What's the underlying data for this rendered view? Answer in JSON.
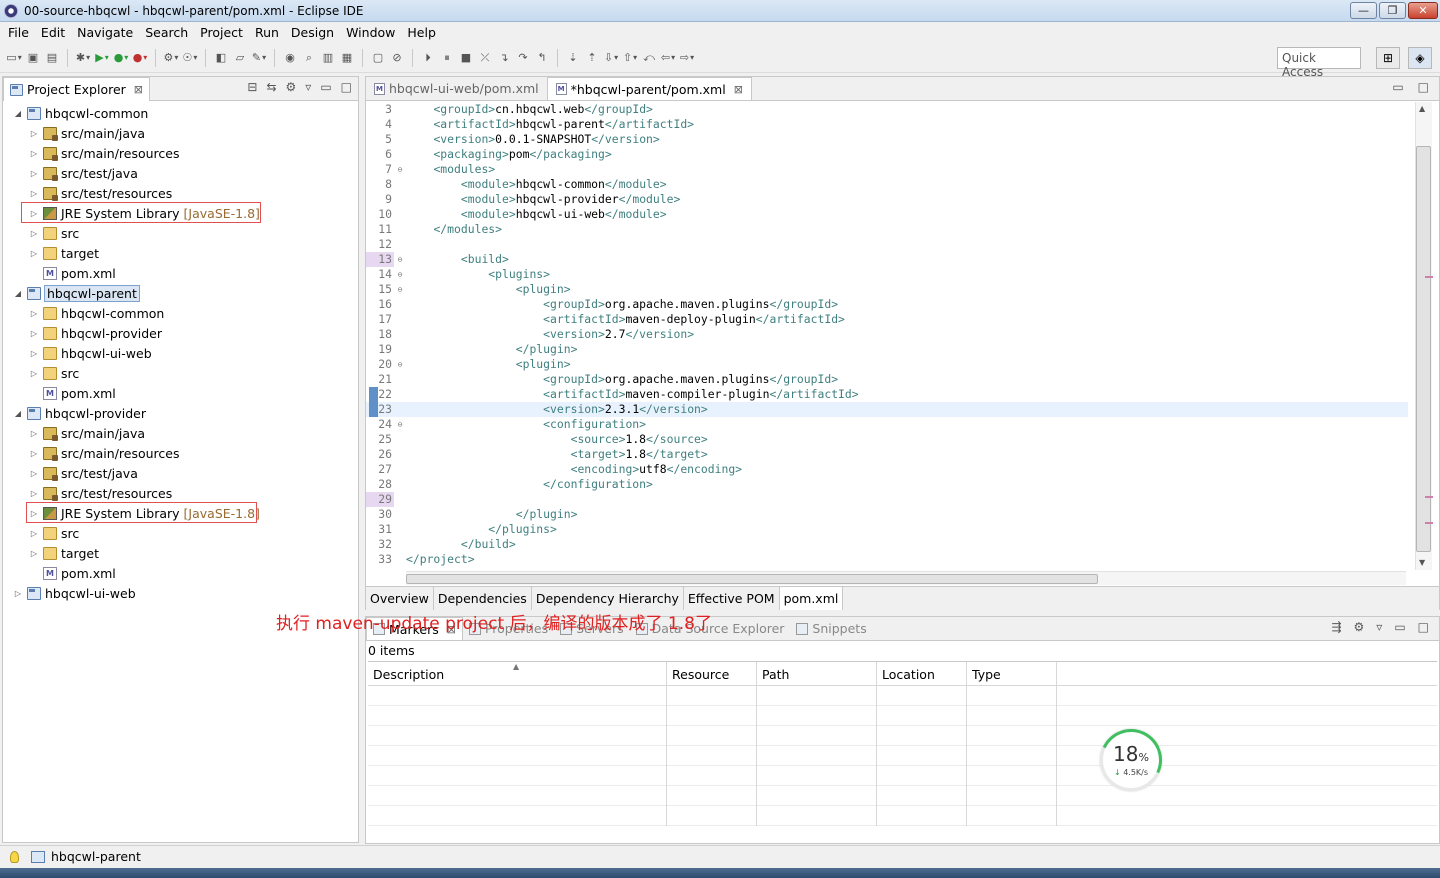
{
  "window": {
    "title": "00-source-hbqcwl - hbqcwl-parent/pom.xml - Eclipse IDE",
    "buttons": [
      "—",
      "❐",
      "✕"
    ]
  },
  "menu": [
    "File",
    "Edit",
    "Navigate",
    "Search",
    "Project",
    "Run",
    "Design",
    "Window",
    "Help"
  ],
  "toolbar": {
    "quick_access": "Quick Access"
  },
  "explorer": {
    "title": "Project Explorer",
    "tree": [
      {
        "label": "hbqcwl-common",
        "icon": "project",
        "level": 0,
        "expanded": true
      },
      {
        "label": "src/main/java",
        "icon": "srcfolder",
        "level": 1
      },
      {
        "label": "src/main/resources",
        "icon": "srcfolder",
        "level": 1
      },
      {
        "label": "src/test/java",
        "icon": "srcfolder",
        "level": 1
      },
      {
        "label": "src/test/resources",
        "icon": "srcfolder",
        "level": 1
      },
      {
        "label": "JRE System Library",
        "extra": "[JavaSE-1.8]",
        "icon": "jar",
        "level": 1,
        "boxed": true
      },
      {
        "label": "src",
        "icon": "folder",
        "level": 1
      },
      {
        "label": "target",
        "icon": "folder",
        "level": 1
      },
      {
        "label": "pom.xml",
        "icon": "pom",
        "level": 1,
        "leaf": true
      },
      {
        "label": "hbqcwl-parent",
        "icon": "project",
        "level": 0,
        "expanded": true,
        "selected": true
      },
      {
        "label": "hbqcwl-common",
        "icon": "folder",
        "level": 1
      },
      {
        "label": "hbqcwl-provider",
        "icon": "folder",
        "level": 1
      },
      {
        "label": "hbqcwl-ui-web",
        "icon": "folder",
        "level": 1
      },
      {
        "label": "src",
        "icon": "folder",
        "level": 1
      },
      {
        "label": "pom.xml",
        "icon": "pom",
        "level": 1,
        "leaf": true
      },
      {
        "label": "hbqcwl-provider",
        "icon": "project",
        "level": 0,
        "expanded": true
      },
      {
        "label": "src/main/java",
        "icon": "srcfolder",
        "level": 1
      },
      {
        "label": "src/main/resources",
        "icon": "srcfolder",
        "level": 1
      },
      {
        "label": "src/test/java",
        "icon": "srcfolder",
        "level": 1
      },
      {
        "label": "src/test/resources",
        "icon": "srcfolder",
        "level": 1
      },
      {
        "label": "JRE System Library",
        "extra": "[JavaSE-1.8]",
        "icon": "jar",
        "level": 1,
        "boxed": true
      },
      {
        "label": "src",
        "icon": "folder",
        "level": 1
      },
      {
        "label": "target",
        "icon": "folder",
        "level": 1
      },
      {
        "label": "pom.xml",
        "icon": "pom",
        "level": 1,
        "leaf": true
      },
      {
        "label": "hbqcwl-ui-web",
        "icon": "project",
        "level": 0,
        "expanded": false
      }
    ]
  },
  "editor": {
    "tabs": [
      {
        "label": "hbqcwl-ui-web/pom.xml",
        "active": false
      },
      {
        "label": "*hbqcwl-parent/pom.xml",
        "active": true
      }
    ],
    "lines": [
      {
        "n": "3",
        "fold": "",
        "indent": "    ",
        "tag": "groupId",
        "value": "cn.hbqcwl.web"
      },
      {
        "n": "4",
        "fold": "",
        "indent": "    ",
        "tag": "artifactId",
        "value": "hbqcwl-parent"
      },
      {
        "n": "5",
        "fold": "",
        "indent": "    ",
        "tag": "version",
        "value": "0.0.1-SNAPSHOT"
      },
      {
        "n": "6",
        "fold": "",
        "indent": "    ",
        "tag": "packaging",
        "value": "pom"
      },
      {
        "n": "7",
        "fold": "⊖",
        "indent": "    ",
        "open": "modules"
      },
      {
        "n": "8",
        "fold": "",
        "indent": "        ",
        "tag": "module",
        "value": "hbqcwl-common"
      },
      {
        "n": "9",
        "fold": "",
        "indent": "        ",
        "tag": "module",
        "value": "hbqcwl-provider"
      },
      {
        "n": "10",
        "fold": "",
        "indent": "        ",
        "tag": "module",
        "value": "hbqcwl-ui-web"
      },
      {
        "n": "11",
        "fold": "",
        "indent": "    ",
        "close": "modules"
      },
      {
        "n": "12",
        "fold": "",
        "indent": ""
      },
      {
        "n": "13",
        "fold": "⊖",
        "indent": "        ",
        "open": "build",
        "hl": true
      },
      {
        "n": "14",
        "fold": "⊖",
        "indent": "            ",
        "open": "plugins"
      },
      {
        "n": "15",
        "fold": "⊖",
        "indent": "                ",
        "open": "plugin"
      },
      {
        "n": "16",
        "fold": "",
        "indent": "                    ",
        "tag": "groupId",
        "value": "org.apache.maven.plugins"
      },
      {
        "n": "17",
        "fold": "",
        "indent": "                    ",
        "tag": "artifactId",
        "value": "maven-deploy-plugin"
      },
      {
        "n": "18",
        "fold": "",
        "indent": "                    ",
        "tag": "version",
        "value": "2.7"
      },
      {
        "n": "19",
        "fold": "",
        "indent": "                ",
        "close": "plugin"
      },
      {
        "n": "20",
        "fold": "⊖",
        "indent": "                ",
        "open": "plugin"
      },
      {
        "n": "21",
        "fold": "",
        "indent": "                    ",
        "tag": "groupId",
        "value": "org.apache.maven.plugins"
      },
      {
        "n": "22",
        "fold": "",
        "indent": "                    ",
        "tag": "artifactId",
        "value": "maven-compiler-plugin",
        "mark": true
      },
      {
        "n": "23",
        "fold": "",
        "indent": "                    ",
        "tag": "version",
        "value": "2.3.1",
        "mark": true,
        "current": true
      },
      {
        "n": "24",
        "fold": "⊖",
        "indent": "                    ",
        "open": "configuration"
      },
      {
        "n": "25",
        "fold": "",
        "indent": "                        ",
        "tag": "source",
        "value": "1.8"
      },
      {
        "n": "26",
        "fold": "",
        "indent": "                        ",
        "tag": "target",
        "value": "1.8"
      },
      {
        "n": "27",
        "fold": "",
        "indent": "                        ",
        "tag": "encoding",
        "value": "utf8"
      },
      {
        "n": "28",
        "fold": "",
        "indent": "                    ",
        "close": "configuration"
      },
      {
        "n": "29",
        "fold": "",
        "indent": "",
        "hl": true
      },
      {
        "n": "30",
        "fold": "",
        "indent": "                ",
        "close": "plugin"
      },
      {
        "n": "31",
        "fold": "",
        "indent": "            ",
        "close": "plugins"
      },
      {
        "n": "32",
        "fold": "",
        "indent": "        ",
        "close": "build"
      },
      {
        "n": "33",
        "fold": "",
        "indent": "",
        "close": "project"
      }
    ],
    "bottom_tabs": [
      "Overview",
      "Dependencies",
      "Dependency Hierarchy",
      "Effective POM",
      "pom.xml"
    ],
    "active_bottom_tab": "pom.xml"
  },
  "annotation": "执行 maven-update project 后，编译的版本成了 1.8了",
  "markers": {
    "tabs": [
      "Markers",
      "Properties",
      "Servers",
      "Data Source Explorer",
      "Snippets"
    ],
    "count": "0 items",
    "columns": [
      "Description",
      "Resource",
      "Path",
      "Location",
      "Type"
    ]
  },
  "speed_widget": {
    "percent": "18",
    "unit": "%",
    "rate": "4.5K/s",
    "fraction": 0.18
  },
  "status": {
    "label": "hbqcwl-parent"
  },
  "colors": {
    "tag": "#3f7f7f",
    "annotation": "#e02020",
    "box": "#e05050"
  }
}
